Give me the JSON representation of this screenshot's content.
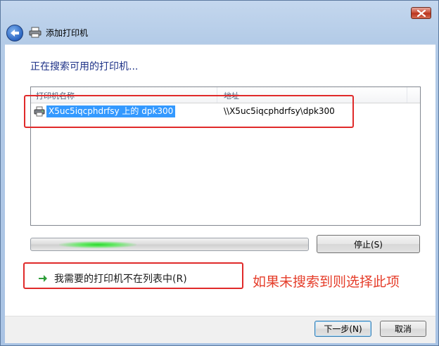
{
  "window": {
    "title": "添加打印机"
  },
  "wizard": {
    "heading": "正在搜索可用的打印机...",
    "list": {
      "columns": [
        "打印机名称",
        "地址"
      ],
      "rows": [
        {
          "name": "X5uc5iqcphdrfsy 上的 dpk300",
          "address": "\\\\X5uc5iqcphdrfsy\\dpk300",
          "icon": "printer-icon",
          "selected": true
        }
      ]
    },
    "progress": {
      "state": "searching"
    },
    "stop_label": "停止(S)",
    "option_label": "我需要的打印机不在列表中(R)"
  },
  "footer": {
    "next_label": "下一步(N)",
    "cancel_label": "取消"
  },
  "annotation": {
    "text": "如果未搜索到则选择此项",
    "color": "#e53d2a"
  },
  "colors": {
    "highlight": "#e02a2a",
    "selection": "#3399ff",
    "heading": "#1e3287"
  }
}
